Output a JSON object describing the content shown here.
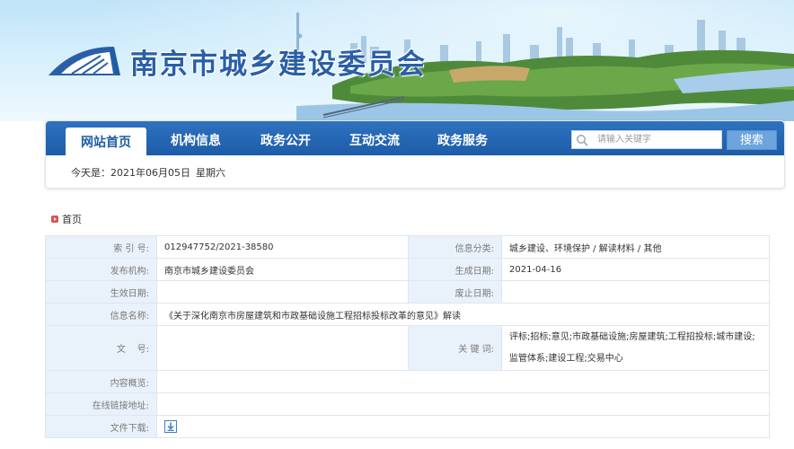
{
  "site": {
    "title": "南京市城乡建设委员会"
  },
  "nav": {
    "items": [
      {
        "label": "网站首页",
        "active": true
      },
      {
        "label": "机构信息",
        "active": false
      },
      {
        "label": "政务公开",
        "active": false
      },
      {
        "label": "互动交流",
        "active": false
      },
      {
        "label": "政务服务",
        "active": false
      }
    ],
    "search": {
      "placeholder": "请输入关键字",
      "button_label": "搜索"
    }
  },
  "today": {
    "label": "今天是：",
    "date": "2021年06月05日",
    "weekday": "星期六"
  },
  "breadcrumb": {
    "home": "首页"
  },
  "info": {
    "index_label": "索 引 号:",
    "index_value": "012947752/2021-38580",
    "category_label": "信息分类:",
    "category_value": "城乡建设、环境保护 / 解读材料 / 其他",
    "publisher_label": "发布机构:",
    "publisher_value": "南京市城乡建设委员会",
    "created_label": "生成日期:",
    "created_value": "2021-04-16",
    "effective_label": "生效日期:",
    "effective_value": "",
    "expire_label": "废止日期:",
    "expire_value": "",
    "name_label": "信息名称:",
    "name_value": "《关于深化南京市房屋建筑和市政基础设施工程招标投标改革的意见》解读",
    "docno_label": "文    号:",
    "docno_value": "",
    "keywords_label": "关 键 词:",
    "keywords_value": "评标;招标;意见;市政基础设施;房屋建筑;工程招投标;城市建设;监管体系;建设工程;交易中心",
    "summary_label": "内容概览:",
    "summary_value": "",
    "link_label": "在线链接地址:",
    "link_value": "",
    "download_label": "文件下载:"
  },
  "colors": {
    "nav_blue": "#1d5ca8",
    "label_bg": "#e9f1fa",
    "title_blue": "#2a5fa8"
  },
  "icons": {
    "logo": "city-logo-icon",
    "search": "search-icon",
    "download": "download-icon",
    "breadcrumb": "breadcrumb-marker-icon"
  }
}
